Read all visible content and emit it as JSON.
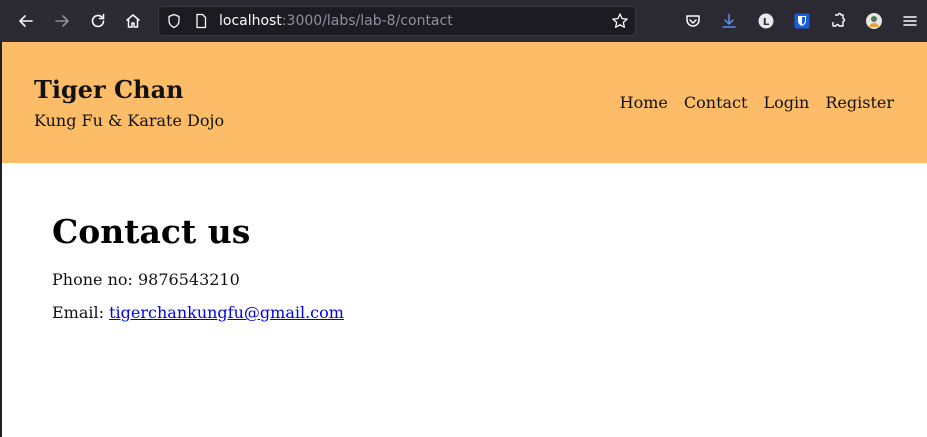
{
  "browser": {
    "url_host": "localhost",
    "url_path": ":3000/labs/lab-8/contact",
    "icons": [
      "back-arrow-icon",
      "forward-arrow-icon",
      "reload-icon",
      "home-icon",
      "shield-icon",
      "page-icon",
      "bookmark-star-icon",
      "pocket-icon",
      "download-icon",
      "account-l-icon",
      "bitwarden-icon",
      "extensions-icon",
      "profile-avatar-icon",
      "hamburger-menu-icon"
    ]
  },
  "header": {
    "title": "Tiger Chan",
    "subtitle": "Kung Fu & Karate Dojo",
    "nav": [
      {
        "label": "Home"
      },
      {
        "label": "Contact"
      },
      {
        "label": "Login"
      },
      {
        "label": "Register"
      }
    ],
    "background_color": "#fdbd68"
  },
  "main": {
    "heading": "Contact us",
    "phone_label": "Phone no:",
    "phone_value": "9876543210",
    "email_label": "Email:",
    "email_value": "tigerchankungfu@gmail.com",
    "link_color": "#0000ee"
  }
}
